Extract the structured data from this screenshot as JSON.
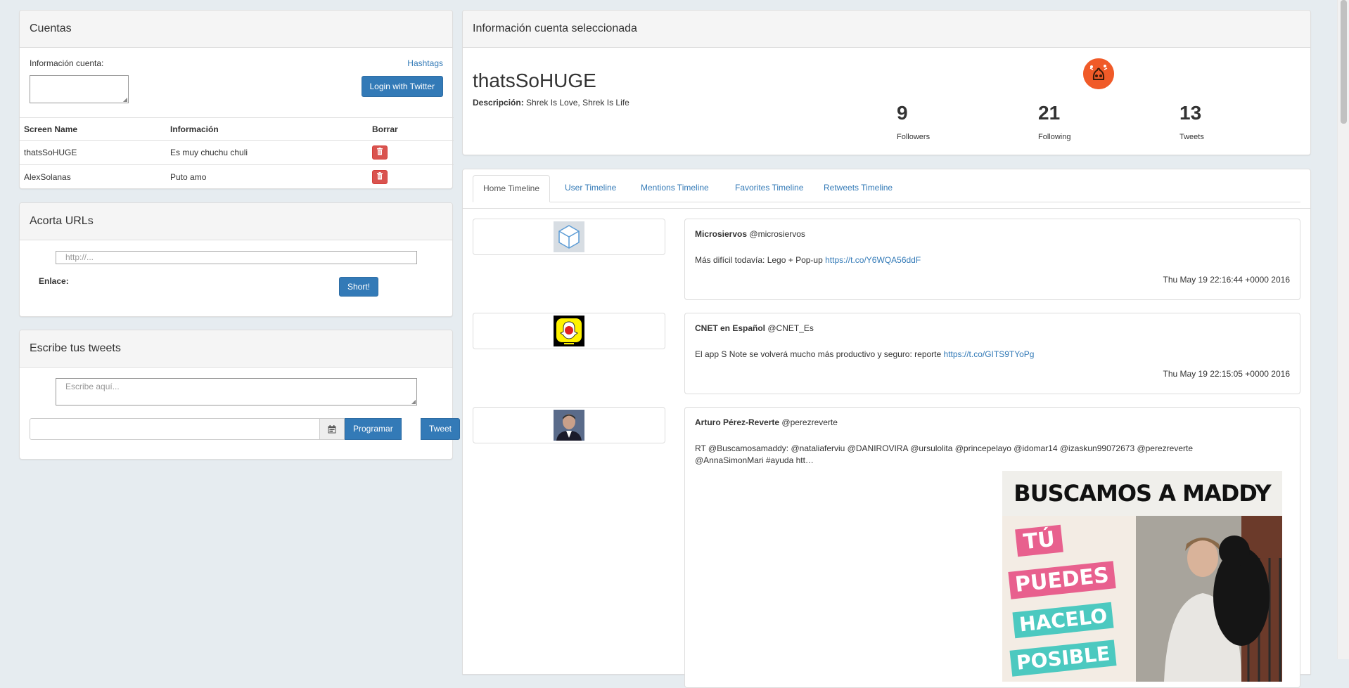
{
  "cuentas": {
    "title": "Cuentas",
    "info_label": "Información cuenta:",
    "hashtags_link": "Hashtags",
    "login_button": "Login with Twitter",
    "columns": [
      "Screen Name",
      "Información",
      "Borrar"
    ],
    "rows": [
      {
        "screen_name": "thatsSoHUGE",
        "info": "Es muy chuchu chuli"
      },
      {
        "screen_name": "AlexSolanas",
        "info": "Puto amo"
      }
    ]
  },
  "acorta": {
    "title": "Acorta URLs",
    "placeholder": "http://...",
    "enlace_label": "Enlace:",
    "short_button": "Short!"
  },
  "escribe": {
    "title": "Escribe tus tweets",
    "placeholder": "Escribe aquí...",
    "programar_button": "Programar",
    "tweet_button": "Tweet"
  },
  "selected": {
    "title": "Información cuenta seleccionada",
    "screen_name": "thatsSoHUGE",
    "desc_label": "Descripción:",
    "desc_value": "Shrek Is Love, Shrek Is Life",
    "stats": [
      {
        "value": "9",
        "label": "Followers"
      },
      {
        "value": "21",
        "label": "Following"
      },
      {
        "value": "13",
        "label": "Tweets"
      }
    ]
  },
  "tabs": [
    {
      "label": "Home Timeline",
      "active": true
    },
    {
      "label": "User Timeline",
      "active": false
    },
    {
      "label": "Mentions Timeline",
      "active": false
    },
    {
      "label": "Favorites Timeline",
      "active": false
    },
    {
      "label": "Retweets Timeline",
      "active": false
    }
  ],
  "tweets": [
    {
      "name": "Microsiervos",
      "handle": "@microsiervos",
      "text": "Más difícil todavía: Lego + Pop-up ",
      "link": "https://t.co/Y6WQA56ddF",
      "date": "Thu May 19 22:16:44 +0000 2016"
    },
    {
      "name": "CNET en Español",
      "handle": "@CNET_Es",
      "text": "El app S Note se volverá mucho más productivo y seguro: reporte ",
      "link": "https://t.co/GITS9TYoPg",
      "date": "Thu May 19 22:15:05 +0000 2016"
    },
    {
      "name": "Arturo Pérez-Reverte",
      "handle": "@perezreverte",
      "text_line1": "RT @Buscamosamaddy: @nataliaferviu @DANIROVIRA @ursulolita @princepelayo @idomar14 @izaskun99072673 @perezreverte",
      "text_line2": "@AnnaSimonMari #ayuda htt…",
      "image_title": "BUSCAMOS A MADDY",
      "image_words": [
        "TÚ",
        "PUEDES",
        "HACELO",
        "POSIBLE"
      ]
    }
  ],
  "colors": {
    "primary": "#337ab7",
    "danger": "#d9534f",
    "background": "#e6ecf0"
  }
}
